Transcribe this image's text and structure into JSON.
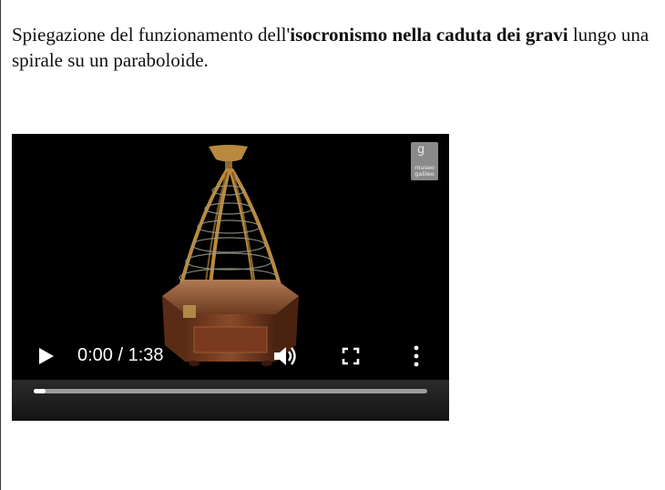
{
  "description": {
    "text_before": "Spiegazione del funzionamento dell'",
    "text_bold": "isocronismo nella caduta dei gravi",
    "text_after": " lungo una spirale su un paraboloide."
  },
  "video": {
    "logo_text": "museo galileo",
    "current_time": "0:00",
    "duration": "1:38",
    "time_display": "0:00 / 1:38",
    "progress_fraction": 0.03,
    "icons": {
      "play": "play-icon",
      "volume": "volume-icon",
      "fullscreen": "fullscreen-icon",
      "more": "more-options-icon"
    }
  }
}
